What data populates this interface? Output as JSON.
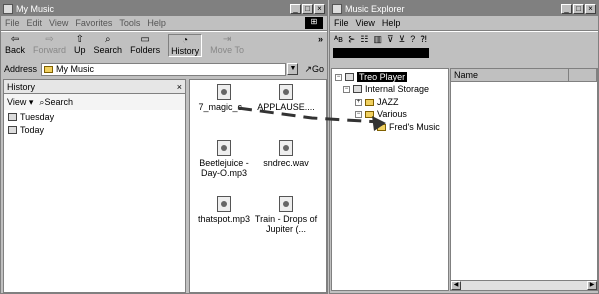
{
  "left_window": {
    "title": "My Music",
    "menu": [
      "File",
      "Edit",
      "View",
      "Favorites",
      "Tools",
      "Help"
    ],
    "toolbar": [
      {
        "label": "Back",
        "glyph": "⇦",
        "disabled": false
      },
      {
        "label": "Forward",
        "glyph": "⇨",
        "disabled": true
      },
      {
        "label": "Up",
        "glyph": "⇧",
        "disabled": false
      },
      {
        "label": "Search",
        "glyph": "⌕",
        "disabled": false
      },
      {
        "label": "Folders",
        "glyph": "▭",
        "disabled": false
      },
      {
        "label": "History",
        "glyph": "◔",
        "disabled": false
      },
      {
        "label": "Move To",
        "glyph": "⇥",
        "disabled": true
      }
    ],
    "address_label": "Address",
    "address_value": "My Music",
    "go_label": "Go",
    "history": {
      "title": "History",
      "view_label": "View",
      "search_label": "Search",
      "items": [
        "Tuesday",
        "Today"
      ]
    },
    "files": [
      "7_magic_c...",
      "APPLAUSE....",
      "Beetlejuice - Day-O.mp3",
      "sndrec.wav",
      "thatspot.mp3",
      "Train - Drops of Jupiter (..."
    ]
  },
  "right_window": {
    "title": "Music Explorer",
    "menu": [
      "File",
      "View",
      "Help"
    ],
    "toolbar_glyphs": [
      "ᴬʙ",
      "⊱",
      "☷",
      "▥",
      "⊽",
      "⊻",
      "?",
      "⁈"
    ],
    "tree": {
      "root": "Treo Player",
      "storage": "Internal Storage",
      "folders": [
        "JAZZ",
        "Various"
      ],
      "subfolder": "Fred's Music"
    },
    "list_columns": [
      "Name"
    ]
  }
}
